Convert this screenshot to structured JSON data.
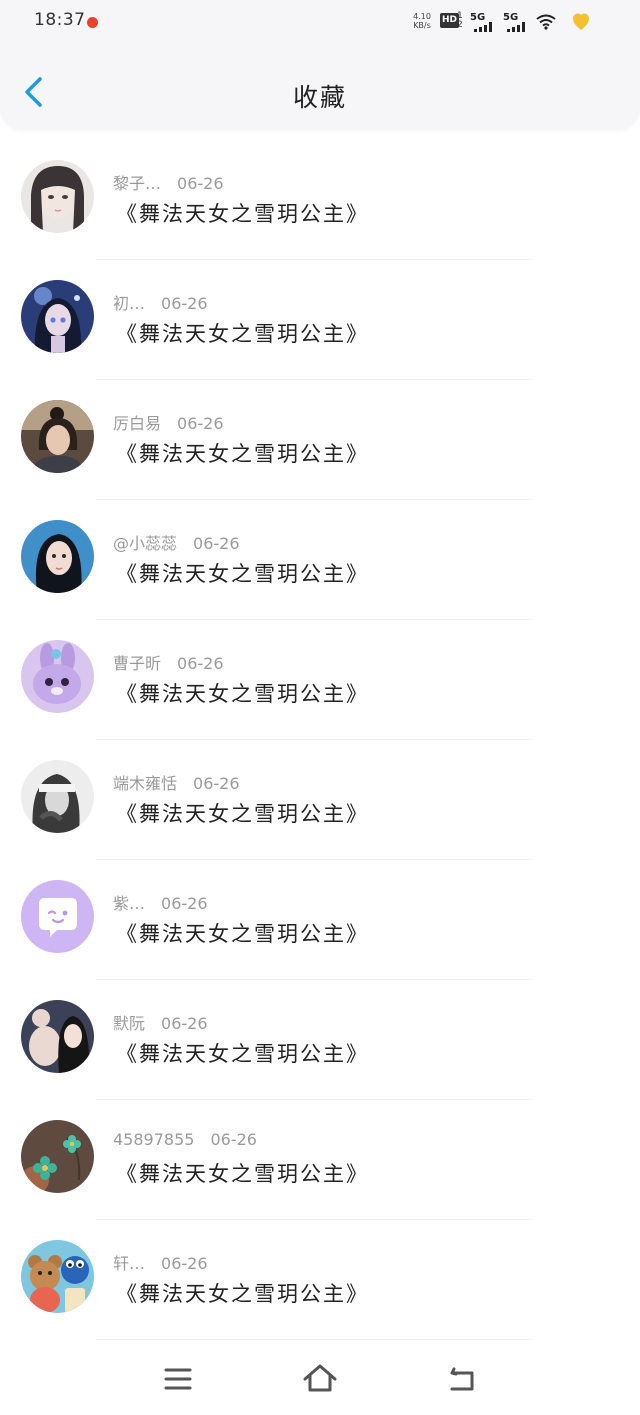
{
  "status_bar": {
    "time": "18:37",
    "net_speed_value": "4.10",
    "net_speed_unit": "KB/s",
    "hd_label": "HD",
    "hd_sub": "1\n2",
    "network_1": "5G",
    "network_2": "5G",
    "icons": [
      "notification-dot-icon",
      "signal-icon",
      "wifi-icon",
      "battery-icon"
    ]
  },
  "header": {
    "back_icon": "chevron-left-icon",
    "title": "收藏"
  },
  "favorites": [
    {
      "author": "黎子…",
      "date": "06-26",
      "title": "《舞法天女之雪玥公主》",
      "avatar": "girl-photo-light"
    },
    {
      "author": "初…",
      "date": "06-26",
      "title": "《舞法天女之雪玥公主》",
      "avatar": "anime-girl-blue"
    },
    {
      "author": "厉白易",
      "date": "06-26",
      "title": "《舞法天女之雪玥公主》",
      "avatar": "girl-photo-dark"
    },
    {
      "author": "@小蕊蕊",
      "date": "06-26",
      "title": "《舞法天女之雪玥公主》",
      "avatar": "girl-portrait-blue"
    },
    {
      "author": "曹子昕",
      "date": "06-26",
      "title": "《舞法天女之雪玥公主》",
      "avatar": "purple-bunny-cartoon"
    },
    {
      "author": "端木雍恬",
      "date": "06-26",
      "title": "《舞法天女之雪玥公主》",
      "avatar": "girl-sketch-bw"
    },
    {
      "author": "紫…",
      "date": "06-26",
      "title": "《舞法天女之雪玥公主》",
      "avatar": "chat-bubble-purple"
    },
    {
      "author": "默阮",
      "date": "06-26",
      "title": "《舞法天女之雪玥公主》",
      "avatar": "girl-with-bear"
    },
    {
      "author": "45897855",
      "date": "06-26",
      "title": "《舞法天女之雪玥公主》",
      "avatar": "teal-flower"
    },
    {
      "author": "轩…",
      "date": "06-26",
      "title": "《舞法天女之雪玥公主》",
      "avatar": "teddy-bear-cookie"
    }
  ],
  "system_nav": {
    "icons": [
      "menu-icon",
      "home-icon",
      "back-icon"
    ]
  },
  "colors": {
    "accent": "#1e9be8",
    "header_bg": "#f6f6f8",
    "meta_text": "#9a9a9a",
    "title_text": "#222222"
  }
}
